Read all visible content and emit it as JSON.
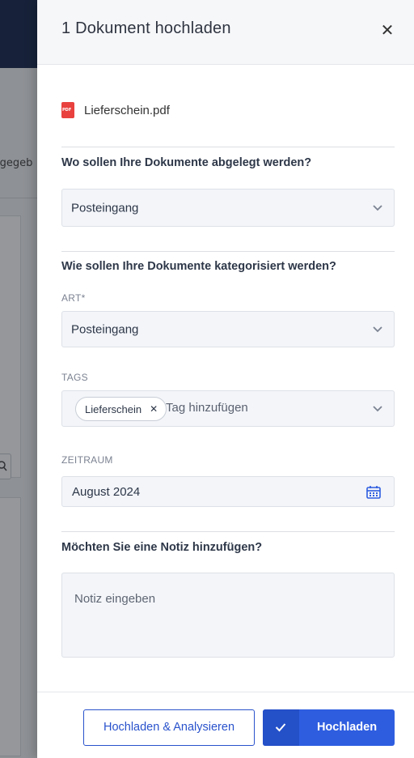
{
  "background": {
    "partial_text": "igegeb"
  },
  "drawer": {
    "title": "1 Dokument hochladen",
    "close_icon": "close-icon",
    "file": {
      "name": "Lieferschein.pdf",
      "icon": "pdf-file-icon",
      "icon_text": "PDF"
    },
    "location_section": {
      "question": "Wo sollen Ihre Dokumente abgelegt werden?",
      "selected": "Posteingang"
    },
    "category_section": {
      "question": "Wie sollen Ihre Dokumente kategorisiert werden?",
      "type_label": "ART*",
      "type_selected": "Posteingang",
      "tags_label": "TAGS",
      "tags": [
        "Lieferschein"
      ],
      "tags_placeholder": "Tag hinzufügen",
      "period_label": "ZEITRAUM",
      "period_value": "August 2024"
    },
    "note_section": {
      "question": "Möchten Sie eine Notiz hinzufügen?",
      "placeholder": "Notiz eingeben"
    },
    "footer": {
      "secondary_label": "Hochladen & Analysieren",
      "primary_label": "Hochladen"
    }
  },
  "colors": {
    "primary": "#2e5de0",
    "primary_dark": "#2450c8",
    "pdf_red": "#e8413e"
  }
}
